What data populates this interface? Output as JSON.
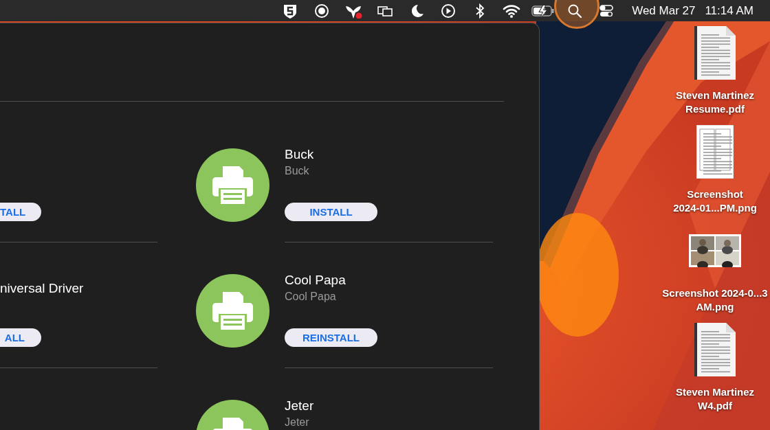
{
  "menu_bar": {
    "extras": [
      {
        "kind": "shield",
        "highlighted": false
      },
      {
        "kind": "record",
        "highlighted": false
      },
      {
        "kind": "bee",
        "highlighted": false
      },
      {
        "kind": "displays",
        "highlighted": false
      },
      {
        "kind": "moon",
        "highlighted": false
      },
      {
        "kind": "play",
        "highlighted": false
      },
      {
        "kind": "bluetooth",
        "highlighted": false
      },
      {
        "kind": "wifi",
        "highlighted": false
      },
      {
        "kind": "battery",
        "highlighted": false
      },
      {
        "kind": "search",
        "highlighted": true
      },
      {
        "kind": "toggles",
        "highlighted": false
      }
    ],
    "date": "Wed Mar 27",
    "time": "11:14 AM"
  },
  "window": {
    "left_column": [
      {
        "button": "TALL"
      },
      {
        "name": "niversal Driver",
        "button": "ALL"
      }
    ],
    "printers": [
      {
        "name": "Buck",
        "subtitle": "Buck",
        "action": "INSTALL"
      },
      {
        "name": "Cool Papa",
        "subtitle": "Cool Papa",
        "action": "REINSTALL"
      },
      {
        "name": "Jeter",
        "subtitle": "Jeter"
      }
    ]
  },
  "desktop_icons": [
    {
      "kind": "document",
      "label": "Steven Martinez Resume.pdf"
    },
    {
      "kind": "form",
      "label": "Screenshot 2024-01...PM.png"
    },
    {
      "label": "Screenshot 2024-0...3 AM.png"
    },
    {
      "kind": "document",
      "label": "Steven Martinez W4.pdf"
    }
  ]
}
